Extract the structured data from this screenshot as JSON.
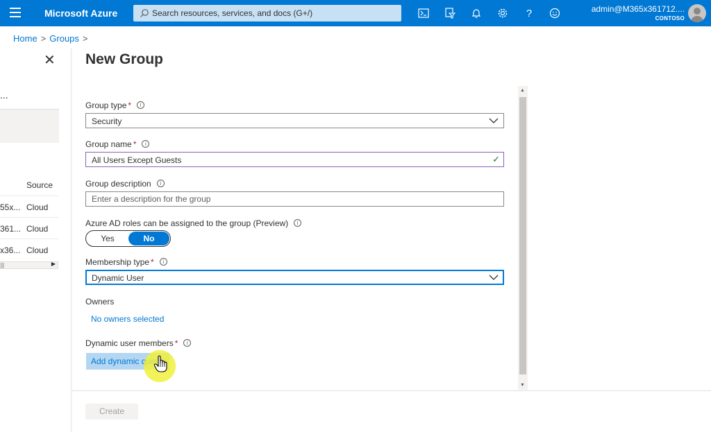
{
  "topbar": {
    "brand": "Microsoft Azure",
    "search_placeholder": "Search resources, services, and docs (G+/)",
    "account_email": "admin@M365x361712....",
    "account_tenant": "CONTOSO",
    "icons": [
      "cloud-shell-icon",
      "directory-filter-icon",
      "notifications-icon",
      "settings-icon",
      "help-icon",
      "feedback-icon"
    ],
    "color": "#0078d4"
  },
  "breadcrumb": [
    "Home",
    "Groups"
  ],
  "left_blade": {
    "ellipsis": "...",
    "column_header": "Source",
    "rows": [
      {
        "name": "55x...",
        "source": "Cloud"
      },
      {
        "name": "361...",
        "source": "Cloud"
      },
      {
        "name": "x36...",
        "source": "Cloud"
      }
    ]
  },
  "main": {
    "title": "New Group",
    "group_type_label": "Group type",
    "group_type_value": "Security",
    "group_name_label": "Group name",
    "group_name_value": "All Users Except Guests",
    "group_desc_label": "Group description",
    "group_desc_placeholder": "Enter a description for the group",
    "roles_label": "Azure AD roles can be assigned to the group (Preview)",
    "roles_yes": "Yes",
    "roles_no": "No",
    "roles_selected": "No",
    "membership_label": "Membership type",
    "membership_value": "Dynamic User",
    "owners_label": "Owners",
    "owners_link": "No owners selected",
    "dynamic_label": "Dynamic user members",
    "dynamic_link": "Add dynamic query",
    "required_mark": "*",
    "info_glyph": "i"
  },
  "footer": {
    "create_label": "Create"
  }
}
